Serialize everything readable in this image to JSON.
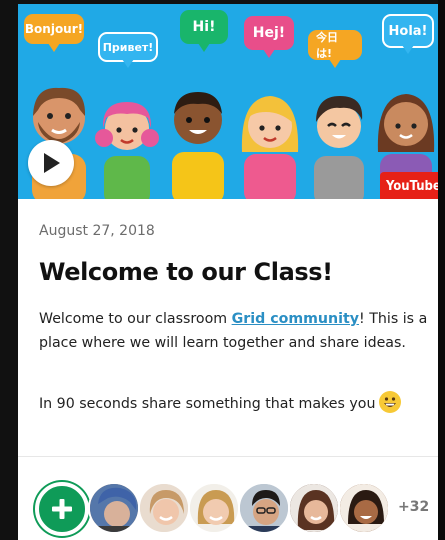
{
  "hero": {
    "bubbles": [
      {
        "text": "Bonjour!",
        "color": "#f5a623"
      },
      {
        "text": "Привет!",
        "color": "#33b5f0"
      },
      {
        "text": "Hi!",
        "color": "#19b56b"
      },
      {
        "text": "Hej!",
        "color": "#e84e8a"
      },
      {
        "text": "今日は!",
        "color": "#f5a623"
      },
      {
        "text": "Hola!",
        "color": "#33b5f0"
      }
    ],
    "youtube_label": "YouTube"
  },
  "post": {
    "date": "August 27, 2018",
    "title": "Welcome to our Class!",
    "para1_before": "Welcome to our classroom ",
    "para1_link": "Grid community",
    "para1_after": "! This is a place where we will learn together and share ideas.",
    "para2": "In 90 seconds share something that makes you"
  },
  "responses": {
    "more_count": "+32"
  },
  "colors": {
    "hero_bg": "#20a9e6",
    "accent_green": "#0f9b58",
    "link": "#2b8fc4"
  }
}
